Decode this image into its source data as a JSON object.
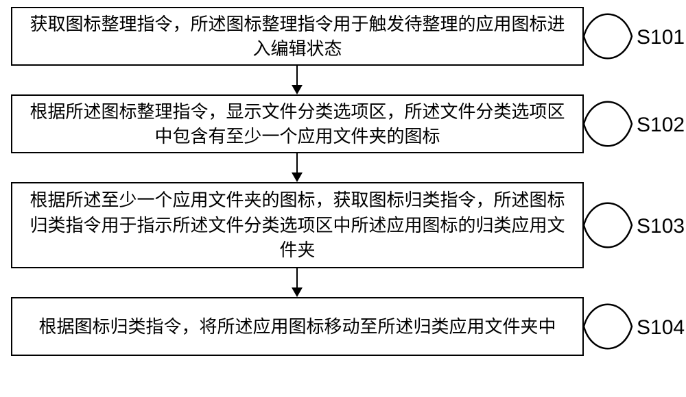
{
  "flow": {
    "boxes": [
      {
        "text": "获取图标整理指令，所述图标整理指令用于触发待整理的应用图标进入编辑状态",
        "label": "S101"
      },
      {
        "text": "根据所述图标整理指令，显示文件分类选项区，所述文件分类选项区中包含有至少一个应用文件夹的图标",
        "label": "S102"
      },
      {
        "text": "根据所述至少一个应用文件夹的图标，获取图标归类指令，所述图标归类指令用于指示所述文件分类选项区中所述应用图标的归类应用文件夹",
        "label": "S103"
      },
      {
        "text": "根据图标归类指令，将所述应用图标移动至所述归类应用文件夹中",
        "label": "S104"
      }
    ]
  }
}
